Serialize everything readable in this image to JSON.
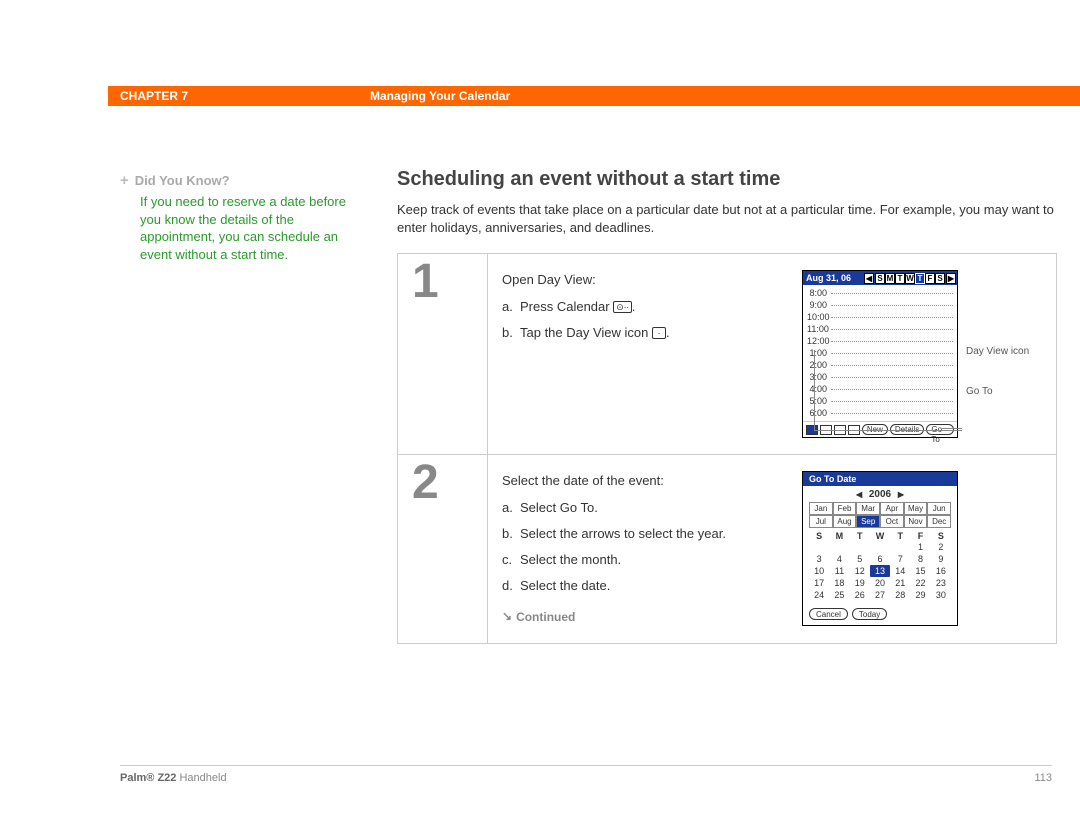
{
  "header": {
    "chapter_label": "CHAPTER 7",
    "chapter_title": "Managing Your Calendar"
  },
  "sidebar": {
    "dyk_label": "Did You Know?",
    "dyk_body": "If you need to reserve a date before you know the details of the appointment, you can schedule an event without a start time."
  },
  "main": {
    "heading": "Scheduling an event without a start time",
    "intro": "Keep track of events that take place on a particular date but not at a particular time. For example, you may want to enter holidays, anniversaries, and deadlines.",
    "continued_label": "Continued"
  },
  "step1": {
    "number": "1",
    "intro": "Open Day View:",
    "a_letter": "a.",
    "a_text": "Press Calendar",
    "b_letter": "b.",
    "b_text": "Tap the Day View icon",
    "callout_dayview": "Day View icon",
    "callout_goto": "Go To",
    "fig": {
      "date": "Aug 31, 06",
      "days": [
        "S",
        "M",
        "T",
        "W",
        "T",
        "F",
        "S"
      ],
      "selected_day_index": 4,
      "times": [
        "8:00",
        "9:00",
        "10:00",
        "11:00",
        "12:00",
        "1:00",
        "2:00",
        "3:00",
        "4:00",
        "5:00",
        "6:00"
      ],
      "btn_new": "New",
      "btn_details": "Details",
      "btn_goto": "Go To"
    }
  },
  "step2": {
    "number": "2",
    "intro": "Select the date of the event:",
    "a_letter": "a.",
    "a_text": "Select Go To.",
    "b_letter": "b.",
    "b_text": "Select the arrows to select the year.",
    "c_letter": "c.",
    "c_text": "Select the month.",
    "d_letter": "d.",
    "d_text": "Select the date.",
    "fig": {
      "title": "Go To Date",
      "year": "2006",
      "months_row1": [
        "Jan",
        "Feb",
        "Mar",
        "Apr",
        "May",
        "Jun"
      ],
      "months_row2": [
        "Jul",
        "Aug",
        "Sep",
        "Oct",
        "Nov",
        "Dec"
      ],
      "selected_month": "Sep",
      "day_headers": [
        "S",
        "M",
        "T",
        "W",
        "T",
        "F",
        "S"
      ],
      "grid": [
        [
          "",
          "",
          "",
          "",
          "",
          "1",
          "2"
        ],
        [
          "3",
          "4",
          "5",
          "6",
          "7",
          "8",
          "9"
        ],
        [
          "10",
          "11",
          "12",
          "13",
          "14",
          "15",
          "16"
        ],
        [
          "17",
          "18",
          "19",
          "20",
          "21",
          "22",
          "23"
        ],
        [
          "24",
          "25",
          "26",
          "27",
          "28",
          "29",
          "30"
        ]
      ],
      "selected_date": "13",
      "btn_cancel": "Cancel",
      "btn_today": "Today"
    }
  },
  "footer": {
    "brand_bold": "Palm® Z22",
    "brand_rest": " Handheld",
    "page": "113"
  }
}
